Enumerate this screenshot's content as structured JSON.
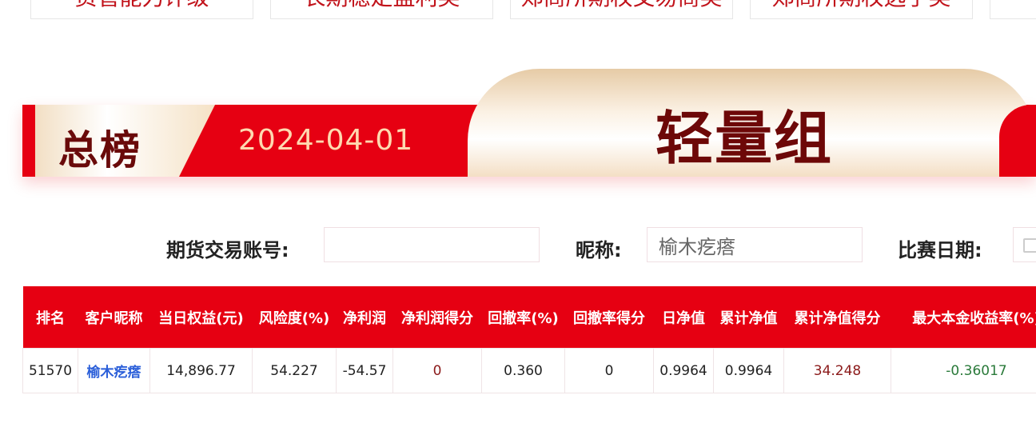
{
  "top_tabs": [
    {
      "label": "资管能力评级"
    },
    {
      "label": "长期稳定盈利奖"
    },
    {
      "label": "郑商所期权交易商奖"
    },
    {
      "label": "郑商所期权选手奖"
    }
  ],
  "banner": {
    "title": "总榜",
    "date": "2024-04-01",
    "group": "轻量组"
  },
  "search": {
    "account_label": "期货交易账号:",
    "account_value": "",
    "nickname_label": "昵称:",
    "nickname_value": "榆木疙瘩",
    "date_label": "比赛日期:"
  },
  "table": {
    "headers": [
      "排名",
      "客户昵称",
      "当日权益(元)",
      "风险度(%)",
      "净利润",
      "净利润得分",
      "回撤率(%)",
      "回撤率得分",
      "日净值",
      "累计净值",
      "累计净值得分",
      "最大本金收益率(%)"
    ],
    "rows": [
      [
        "51570",
        "榆木疙瘩",
        "14,896.77",
        "54.227",
        "-54.57",
        "0",
        "0.360",
        "0",
        "0.9964",
        "0.9964",
        "34.248",
        "-0.36017"
      ]
    ]
  }
}
